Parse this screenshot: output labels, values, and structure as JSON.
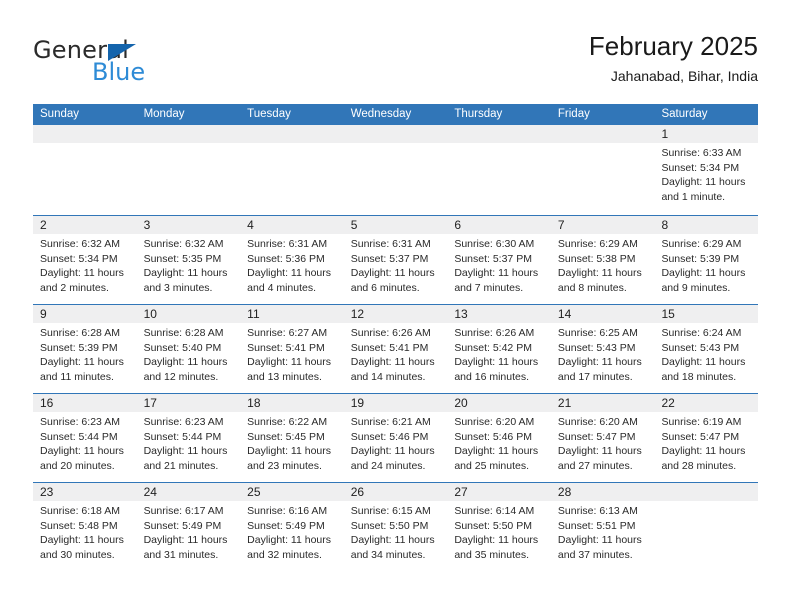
{
  "logo": {
    "word_one": "General",
    "word_two": "Blue",
    "triangle_icon": "triangle-icon",
    "brand_dark": "#2b2b2b",
    "brand_blue": "#2e8bd6",
    "triangle_blue": "#1464ac"
  },
  "header": {
    "title": "February 2025",
    "subtitle": "Jahanabad, Bihar, India"
  },
  "colors": {
    "header_bar": "#3176b8",
    "day_band": "#efeff0",
    "row_divider": "#3176b8",
    "text": "#2a2a2a"
  },
  "weekdays": [
    "Sunday",
    "Monday",
    "Tuesday",
    "Wednesday",
    "Thursday",
    "Friday",
    "Saturday"
  ],
  "weeks": [
    [
      {
        "day": "",
        "lines": []
      },
      {
        "day": "",
        "lines": []
      },
      {
        "day": "",
        "lines": []
      },
      {
        "day": "",
        "lines": []
      },
      {
        "day": "",
        "lines": []
      },
      {
        "day": "",
        "lines": []
      },
      {
        "day": "1",
        "lines": [
          "Sunrise: 6:33 AM",
          "Sunset: 5:34 PM",
          "Daylight: 11 hours",
          "and 1 minute."
        ]
      }
    ],
    [
      {
        "day": "2",
        "lines": [
          "Sunrise: 6:32 AM",
          "Sunset: 5:34 PM",
          "Daylight: 11 hours",
          "and 2 minutes."
        ]
      },
      {
        "day": "3",
        "lines": [
          "Sunrise: 6:32 AM",
          "Sunset: 5:35 PM",
          "Daylight: 11 hours",
          "and 3 minutes."
        ]
      },
      {
        "day": "4",
        "lines": [
          "Sunrise: 6:31 AM",
          "Sunset: 5:36 PM",
          "Daylight: 11 hours",
          "and 4 minutes."
        ]
      },
      {
        "day": "5",
        "lines": [
          "Sunrise: 6:31 AM",
          "Sunset: 5:37 PM",
          "Daylight: 11 hours",
          "and 6 minutes."
        ]
      },
      {
        "day": "6",
        "lines": [
          "Sunrise: 6:30 AM",
          "Sunset: 5:37 PM",
          "Daylight: 11 hours",
          "and 7 minutes."
        ]
      },
      {
        "day": "7",
        "lines": [
          "Sunrise: 6:29 AM",
          "Sunset: 5:38 PM",
          "Daylight: 11 hours",
          "and 8 minutes."
        ]
      },
      {
        "day": "8",
        "lines": [
          "Sunrise: 6:29 AM",
          "Sunset: 5:39 PM",
          "Daylight: 11 hours",
          "and 9 minutes."
        ]
      }
    ],
    [
      {
        "day": "9",
        "lines": [
          "Sunrise: 6:28 AM",
          "Sunset: 5:39 PM",
          "Daylight: 11 hours",
          "and 11 minutes."
        ]
      },
      {
        "day": "10",
        "lines": [
          "Sunrise: 6:28 AM",
          "Sunset: 5:40 PM",
          "Daylight: 11 hours",
          "and 12 minutes."
        ]
      },
      {
        "day": "11",
        "lines": [
          "Sunrise: 6:27 AM",
          "Sunset: 5:41 PM",
          "Daylight: 11 hours",
          "and 13 minutes."
        ]
      },
      {
        "day": "12",
        "lines": [
          "Sunrise: 6:26 AM",
          "Sunset: 5:41 PM",
          "Daylight: 11 hours",
          "and 14 minutes."
        ]
      },
      {
        "day": "13",
        "lines": [
          "Sunrise: 6:26 AM",
          "Sunset: 5:42 PM",
          "Daylight: 11 hours",
          "and 16 minutes."
        ]
      },
      {
        "day": "14",
        "lines": [
          "Sunrise: 6:25 AM",
          "Sunset: 5:43 PM",
          "Daylight: 11 hours",
          "and 17 minutes."
        ]
      },
      {
        "day": "15",
        "lines": [
          "Sunrise: 6:24 AM",
          "Sunset: 5:43 PM",
          "Daylight: 11 hours",
          "and 18 minutes."
        ]
      }
    ],
    [
      {
        "day": "16",
        "lines": [
          "Sunrise: 6:23 AM",
          "Sunset: 5:44 PM",
          "Daylight: 11 hours",
          "and 20 minutes."
        ]
      },
      {
        "day": "17",
        "lines": [
          "Sunrise: 6:23 AM",
          "Sunset: 5:44 PM",
          "Daylight: 11 hours",
          "and 21 minutes."
        ]
      },
      {
        "day": "18",
        "lines": [
          "Sunrise: 6:22 AM",
          "Sunset: 5:45 PM",
          "Daylight: 11 hours",
          "and 23 minutes."
        ]
      },
      {
        "day": "19",
        "lines": [
          "Sunrise: 6:21 AM",
          "Sunset: 5:46 PM",
          "Daylight: 11 hours",
          "and 24 minutes."
        ]
      },
      {
        "day": "20",
        "lines": [
          "Sunrise: 6:20 AM",
          "Sunset: 5:46 PM",
          "Daylight: 11 hours",
          "and 25 minutes."
        ]
      },
      {
        "day": "21",
        "lines": [
          "Sunrise: 6:20 AM",
          "Sunset: 5:47 PM",
          "Daylight: 11 hours",
          "and 27 minutes."
        ]
      },
      {
        "day": "22",
        "lines": [
          "Sunrise: 6:19 AM",
          "Sunset: 5:47 PM",
          "Daylight: 11 hours",
          "and 28 minutes."
        ]
      }
    ],
    [
      {
        "day": "23",
        "lines": [
          "Sunrise: 6:18 AM",
          "Sunset: 5:48 PM",
          "Daylight: 11 hours",
          "and 30 minutes."
        ]
      },
      {
        "day": "24",
        "lines": [
          "Sunrise: 6:17 AM",
          "Sunset: 5:49 PM",
          "Daylight: 11 hours",
          "and 31 minutes."
        ]
      },
      {
        "day": "25",
        "lines": [
          "Sunrise: 6:16 AM",
          "Sunset: 5:49 PM",
          "Daylight: 11 hours",
          "and 32 minutes."
        ]
      },
      {
        "day": "26",
        "lines": [
          "Sunrise: 6:15 AM",
          "Sunset: 5:50 PM",
          "Daylight: 11 hours",
          "and 34 minutes."
        ]
      },
      {
        "day": "27",
        "lines": [
          "Sunrise: 6:14 AM",
          "Sunset: 5:50 PM",
          "Daylight: 11 hours",
          "and 35 minutes."
        ]
      },
      {
        "day": "28",
        "lines": [
          "Sunrise: 6:13 AM",
          "Sunset: 5:51 PM",
          "Daylight: 11 hours",
          "and 37 minutes."
        ]
      },
      {
        "day": "",
        "lines": []
      }
    ]
  ]
}
